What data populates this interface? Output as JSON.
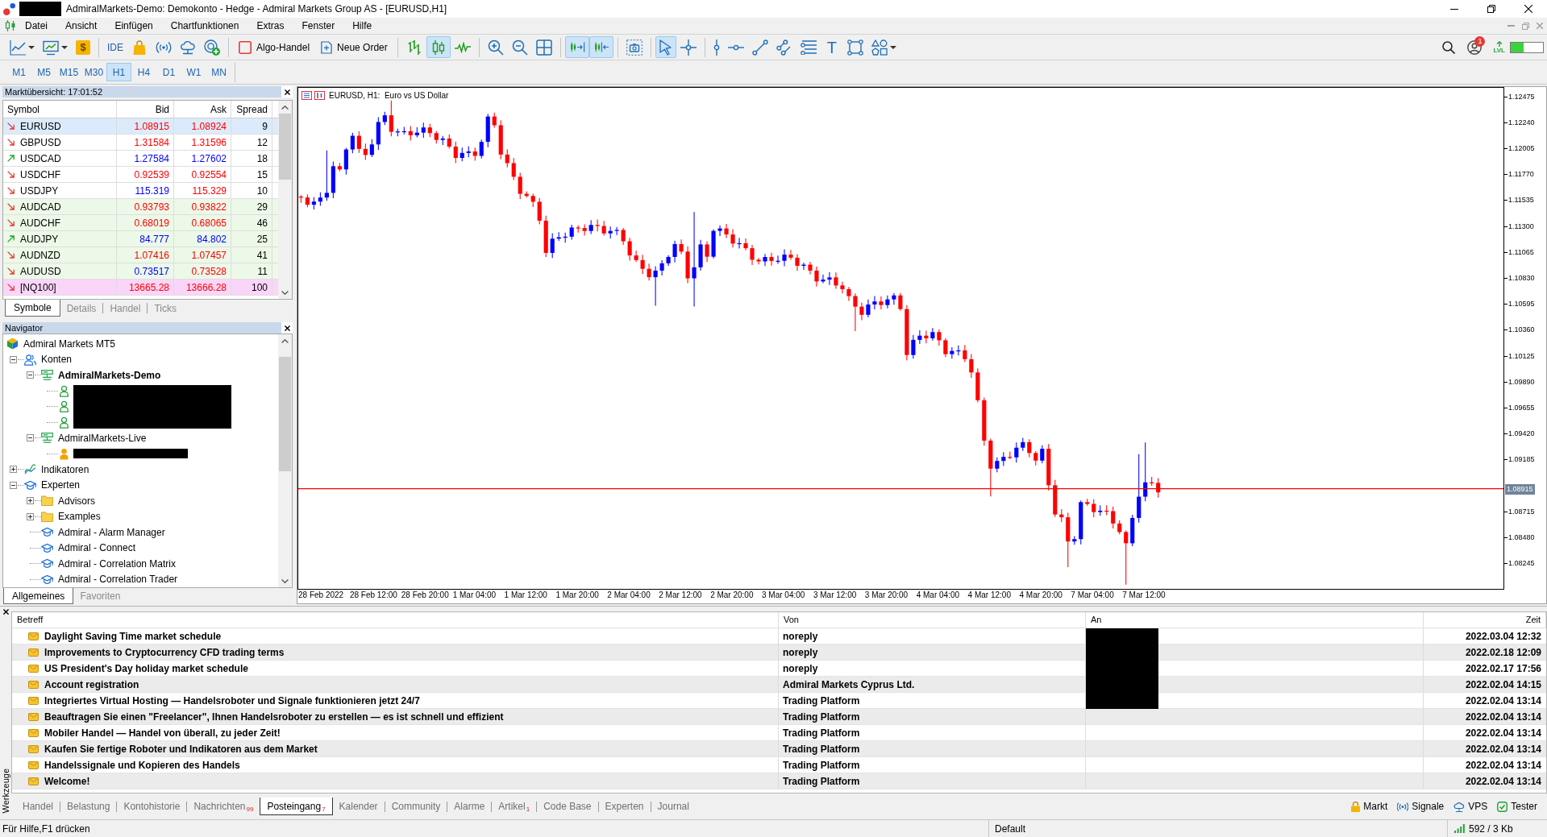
{
  "window": {
    "title": "AdmiralMarkets-Demo: Demokonto - Hedge - Admiral Markets Group AS - [EURUSD,H1]"
  },
  "menu": [
    "Datei",
    "Ansicht",
    "Einfügen",
    "Chartfunktionen",
    "Extras",
    "Fenster",
    "Hilfe"
  ],
  "toolbar": {
    "groups": [
      [
        {
          "kind": "icon",
          "pressed": false,
          "menu": true
        },
        {
          "kind": "icon",
          "pressed": false,
          "menu": true
        },
        {
          "kind": "tile",
          "glyph": "$",
          "pressed": false
        }
      ],
      [
        {
          "kind": "text",
          "label": "IDE",
          "pressed": false
        },
        {
          "kind": "icon",
          "pressed": false
        },
        {
          "kind": "icon",
          "pressed": false
        },
        {
          "kind": "icon",
          "pressed": false
        },
        {
          "kind": "icon",
          "pressed": false
        }
      ],
      [
        {
          "kind": "labeled",
          "label": "Algo-Handel",
          "pressed": false
        },
        {
          "kind": "labeled",
          "label": "Neue Order",
          "pressed": false
        }
      ],
      [
        {
          "kind": "icon",
          "pressed": false
        },
        {
          "kind": "icon",
          "pressed": true
        },
        {
          "kind": "icon",
          "pressed": false
        }
      ],
      [
        {
          "kind": "icon",
          "pressed": false
        },
        {
          "kind": "icon",
          "pressed": false
        },
        {
          "kind": "icon",
          "pressed": false
        }
      ],
      [
        {
          "kind": "icon",
          "pressed": true
        },
        {
          "kind": "icon",
          "pressed": true
        }
      ],
      [
        {
          "kind": "icon",
          "pressed": false
        }
      ],
      [
        {
          "kind": "icon",
          "pressed": true
        },
        {
          "kind": "icon",
          "pressed": false
        }
      ],
      [
        {
          "kind": "icon",
          "pressed": false
        },
        {
          "kind": "icon",
          "pressed": false
        },
        {
          "kind": "icon",
          "pressed": false
        },
        {
          "kind": "icon",
          "pressed": false
        },
        {
          "kind": "icon",
          "pressed": false
        },
        {
          "kind": "glyph",
          "glyph": "T",
          "pressed": false
        },
        {
          "kind": "icon",
          "pressed": false
        },
        {
          "kind": "icon",
          "pressed": false,
          "menu": true
        }
      ]
    ]
  },
  "toolbar_status": {
    "notification_count": "1",
    "level_badge": "LVL",
    "meter": {
      "level": 0.4
    }
  },
  "timeframes": [
    {
      "label": "M1",
      "selected": false
    },
    {
      "label": "M5",
      "selected": false
    },
    {
      "label": "M15",
      "selected": false
    },
    {
      "label": "M30",
      "selected": false
    },
    {
      "label": "H1",
      "selected": true
    },
    {
      "label": "H4",
      "selected": false
    },
    {
      "label": "D1",
      "selected": false
    },
    {
      "label": "W1",
      "selected": false
    },
    {
      "label": "MN",
      "selected": false
    }
  ],
  "market_watch": {
    "title": "Marktübersicht: 17:01:52",
    "columns": [
      "Symbol",
      "Bid",
      "Ask",
      "Spread"
    ],
    "rows": [
      {
        "kind": "falling",
        "symbol": "EURUSD",
        "bid": {
          "value": "1.08915",
          "color": "#ff0000"
        },
        "ask": {
          "value": "1.08924",
          "color": "#ff0000"
        },
        "spread": "9",
        "selected": true
      },
      {
        "kind": "falling",
        "symbol": "GBPUSD",
        "bid": {
          "value": "1.31584",
          "color": "#ff0000"
        },
        "ask": {
          "value": "1.31596",
          "color": "#ff0000"
        },
        "spread": "12",
        "color": "#ffffff",
        "selected": false
      },
      {
        "kind": "rising",
        "symbol": "USDCAD",
        "bid": {
          "value": "1.27584",
          "color": "#0000ff"
        },
        "ask": {
          "value": "1.27602",
          "color": "#0000ff"
        },
        "spread": "18",
        "color": "#ffffff",
        "selected": false
      },
      {
        "kind": "falling",
        "symbol": "USDCHF",
        "bid": {
          "value": "0.92539",
          "color": "#ff0000"
        },
        "ask": {
          "value": "0.92554",
          "color": "#ff0000"
        },
        "spread": "15",
        "color": "#ffffff",
        "selected": false
      },
      {
        "kind": "falling",
        "symbol": "USDJPY",
        "bid": {
          "value": "115.319",
          "color": "#0000ff"
        },
        "ask": {
          "value": "115.329",
          "color": "#ff0000"
        },
        "spread": "10",
        "color": "#ffffff",
        "selected": false
      },
      {
        "kind": "falling",
        "symbol": "AUDCAD",
        "bid": {
          "value": "0.93793",
          "color": "#ff0000"
        },
        "ask": {
          "value": "0.93822",
          "color": "#ff0000"
        },
        "spread": "29",
        "color": "#ecf9e8",
        "selected": false
      },
      {
        "kind": "falling",
        "symbol": "AUDCHF",
        "bid": {
          "value": "0.68019",
          "color": "#ff0000"
        },
        "ask": {
          "value": "0.68065",
          "color": "#ff0000"
        },
        "spread": "46",
        "color": "#ecf9e8",
        "selected": false
      },
      {
        "kind": "rising",
        "symbol": "AUDJPY",
        "bid": {
          "value": "84.777",
          "color": "#0000ff"
        },
        "ask": {
          "value": "84.802",
          "color": "#0000ff"
        },
        "spread": "25",
        "color": "#ecf9e8",
        "selected": false
      },
      {
        "kind": "falling",
        "symbol": "AUDNZD",
        "bid": {
          "value": "1.07416",
          "color": "#ff0000"
        },
        "ask": {
          "value": "1.07457",
          "color": "#ff0000"
        },
        "spread": "41",
        "color": "#ecf9e8",
        "selected": false
      },
      {
        "kind": "falling",
        "symbol": "AUDUSD",
        "bid": {
          "value": "0.73517",
          "color": "#0000ff"
        },
        "ask": {
          "value": "0.73528",
          "color": "#ff0000"
        },
        "spread": "11",
        "color": "#ecf9e8",
        "selected": false
      },
      {
        "kind": "falling",
        "symbol": "[NQ100]",
        "bid": {
          "value": "13665.28",
          "color": "#ff0000"
        },
        "ask": {
          "value": "13666.28",
          "color": "#ff0000"
        },
        "spread": "100",
        "color": "#fbd5f9",
        "selected": false
      }
    ],
    "tabs": [
      {
        "label": "Symbole",
        "selected": true
      },
      {
        "label": "Details",
        "selected": false
      },
      {
        "label": "Handel",
        "selected": false
      },
      {
        "label": "Ticks",
        "selected": false
      }
    ]
  },
  "navigator": {
    "title": "Navigator",
    "tree": [
      {
        "label": "Admiral Markets MT5",
        "kind": "platform",
        "children": [
          {
            "label": "Konten",
            "kind": "accounts",
            "expanded": true,
            "children": [
              {
                "label": "AdmiralMarkets-Demo",
                "kind": "server",
                "expanded": true,
                "active": true,
                "children": [
                  {
                    "kind": "demo-account",
                    "redacted": true
                  },
                  {
                    "kind": "demo-account",
                    "redacted": true
                  },
                  {
                    "kind": "demo-account",
                    "redacted": true
                  }
                ]
              },
              {
                "label": "AdmiralMarkets-Live",
                "kind": "server",
                "expanded": true,
                "active": false,
                "children": [
                  {
                    "kind": "live-account",
                    "redacted": true
                  }
                ]
              }
            ]
          },
          {
            "label": "Indikatoren",
            "kind": "indicators",
            "expanded": false
          },
          {
            "label": "Experten",
            "kind": "experts",
            "expanded": true,
            "children": [
              {
                "label": "Advisors",
                "kind": "folder",
                "expanded": false
              },
              {
                "label": "Examples",
                "kind": "folder",
                "expanded": false
              },
              {
                "label": "Admiral - Alarm Manager",
                "kind": "expert"
              },
              {
                "label": "Admiral - Connect",
                "kind": "expert"
              },
              {
                "label": "Admiral - Correlation Matrix",
                "kind": "expert"
              },
              {
                "label": "Admiral - Correlation Trader",
                "kind": "expert"
              }
            ]
          }
        ]
      }
    ],
    "tabs": [
      {
        "label": "Allgemeines",
        "selected": true
      },
      {
        "label": "Favoriten",
        "selected": false
      }
    ]
  },
  "chart": {
    "title": "EURUSD, H1:  Euro vs US Dollar",
    "price_ticks": [
      "1.12475",
      "1.12240",
      "1.12005",
      "1.11770",
      "1.11535",
      "1.11300",
      "1.11065",
      "1.10830",
      "1.10595",
      "1.10360",
      "1.10125",
      "1.09890",
      "1.09655",
      "1.09420",
      "1.09185",
      "1.08715",
      "1.08480",
      "1.08245"
    ],
    "bid_label": "1.08915",
    "time_ticks": [
      "28 Feb 2022",
      "28 Feb 12:00",
      "28 Feb 20:00",
      "1 Mar 04:00",
      "1 Mar 12:00",
      "1 Mar 20:00",
      "2 Mar 04:00",
      "2 Mar 12:00",
      "2 Mar 20:00",
      "3 Mar 04:00",
      "3 Mar 12:00",
      "3 Mar 20:00",
      "4 Mar 04:00",
      "4 Mar 12:00",
      "4 Mar 20:00",
      "7 Mar 04:00",
      "7 Mar 12:00"
    ]
  },
  "toolbox": {
    "side_label": "Werkzeuge",
    "columns": [
      "Betreff",
      "Von",
      "An",
      "Zeit"
    ],
    "rows": [
      {
        "subject": "Daylight Saving Time market schedule",
        "from": "noreply",
        "redacted": true,
        "time": "2022.03.04 12:32"
      },
      {
        "subject": "Improvements to Cryptocurrency CFD trading terms",
        "from": "noreply",
        "redacted": true,
        "time": "2022.02.18 12:09"
      },
      {
        "subject": "US President's Day holiday market schedule",
        "from": "noreply",
        "redacted": true,
        "time": "2022.02.17 17:56"
      },
      {
        "subject": "Account registration",
        "from": "Admiral Markets Cyprus Ltd.",
        "redacted": true,
        "time": "2022.02.04 14:15"
      },
      {
        "subject": "Integriertes Virtual Hosting — Handelsroboter und Signale funktionieren jetzt 24/7",
        "from": "Trading Platform",
        "redacted": true,
        "time": "2022.02.04 13:14"
      },
      {
        "subject": "Beauftragen Sie einen \"Freelancer\", Ihnen Handelsroboter zu erstellen — es ist schnell und effizient",
        "from": "Trading Platform",
        "redacted": false,
        "time": "2022.02.04 13:14"
      },
      {
        "subject": "Mobiler Handel — Handel von überall, zu jeder Zeit!",
        "from": "Trading Platform",
        "redacted": false,
        "time": "2022.02.04 13:14"
      },
      {
        "subject": "Kaufen Sie fertige Roboter und Indikatoren aus dem Market",
        "from": "Trading Platform",
        "redacted": false,
        "time": "2022.02.04 13:14"
      },
      {
        "subject": "Handelssignale und Kopieren des Handels",
        "from": "Trading Platform",
        "redacted": false,
        "time": "2022.02.04 13:14"
      },
      {
        "subject": "Welcome!",
        "from": "Trading Platform",
        "redacted": false,
        "time": "2022.02.04 13:14"
      }
    ],
    "tabs": [
      {
        "label": "Handel",
        "selected": false
      },
      {
        "label": "Belastung",
        "selected": false
      },
      {
        "label": "Kontohistorie",
        "selected": false
      },
      {
        "label": "Nachrichten",
        "count": "99",
        "selected": false
      },
      {
        "label": "Posteingang",
        "count": "7",
        "selected": true
      },
      {
        "label": "Kalender",
        "selected": false
      },
      {
        "label": "Community",
        "selected": false
      },
      {
        "label": "Alarme",
        "selected": false
      },
      {
        "label": "Artikel",
        "count": "1",
        "selected": false
      },
      {
        "label": "Code Base",
        "selected": false
      },
      {
        "label": "Experten",
        "selected": false
      },
      {
        "label": "Journal",
        "selected": false
      }
    ],
    "services": [
      "Markt",
      "Signale",
      "VPS",
      "Tester"
    ]
  },
  "status_bar": {
    "help": "Für Hilfe,F1 drücken",
    "profile": "Default",
    "traffic": "592 / 3 Kb"
  }
}
